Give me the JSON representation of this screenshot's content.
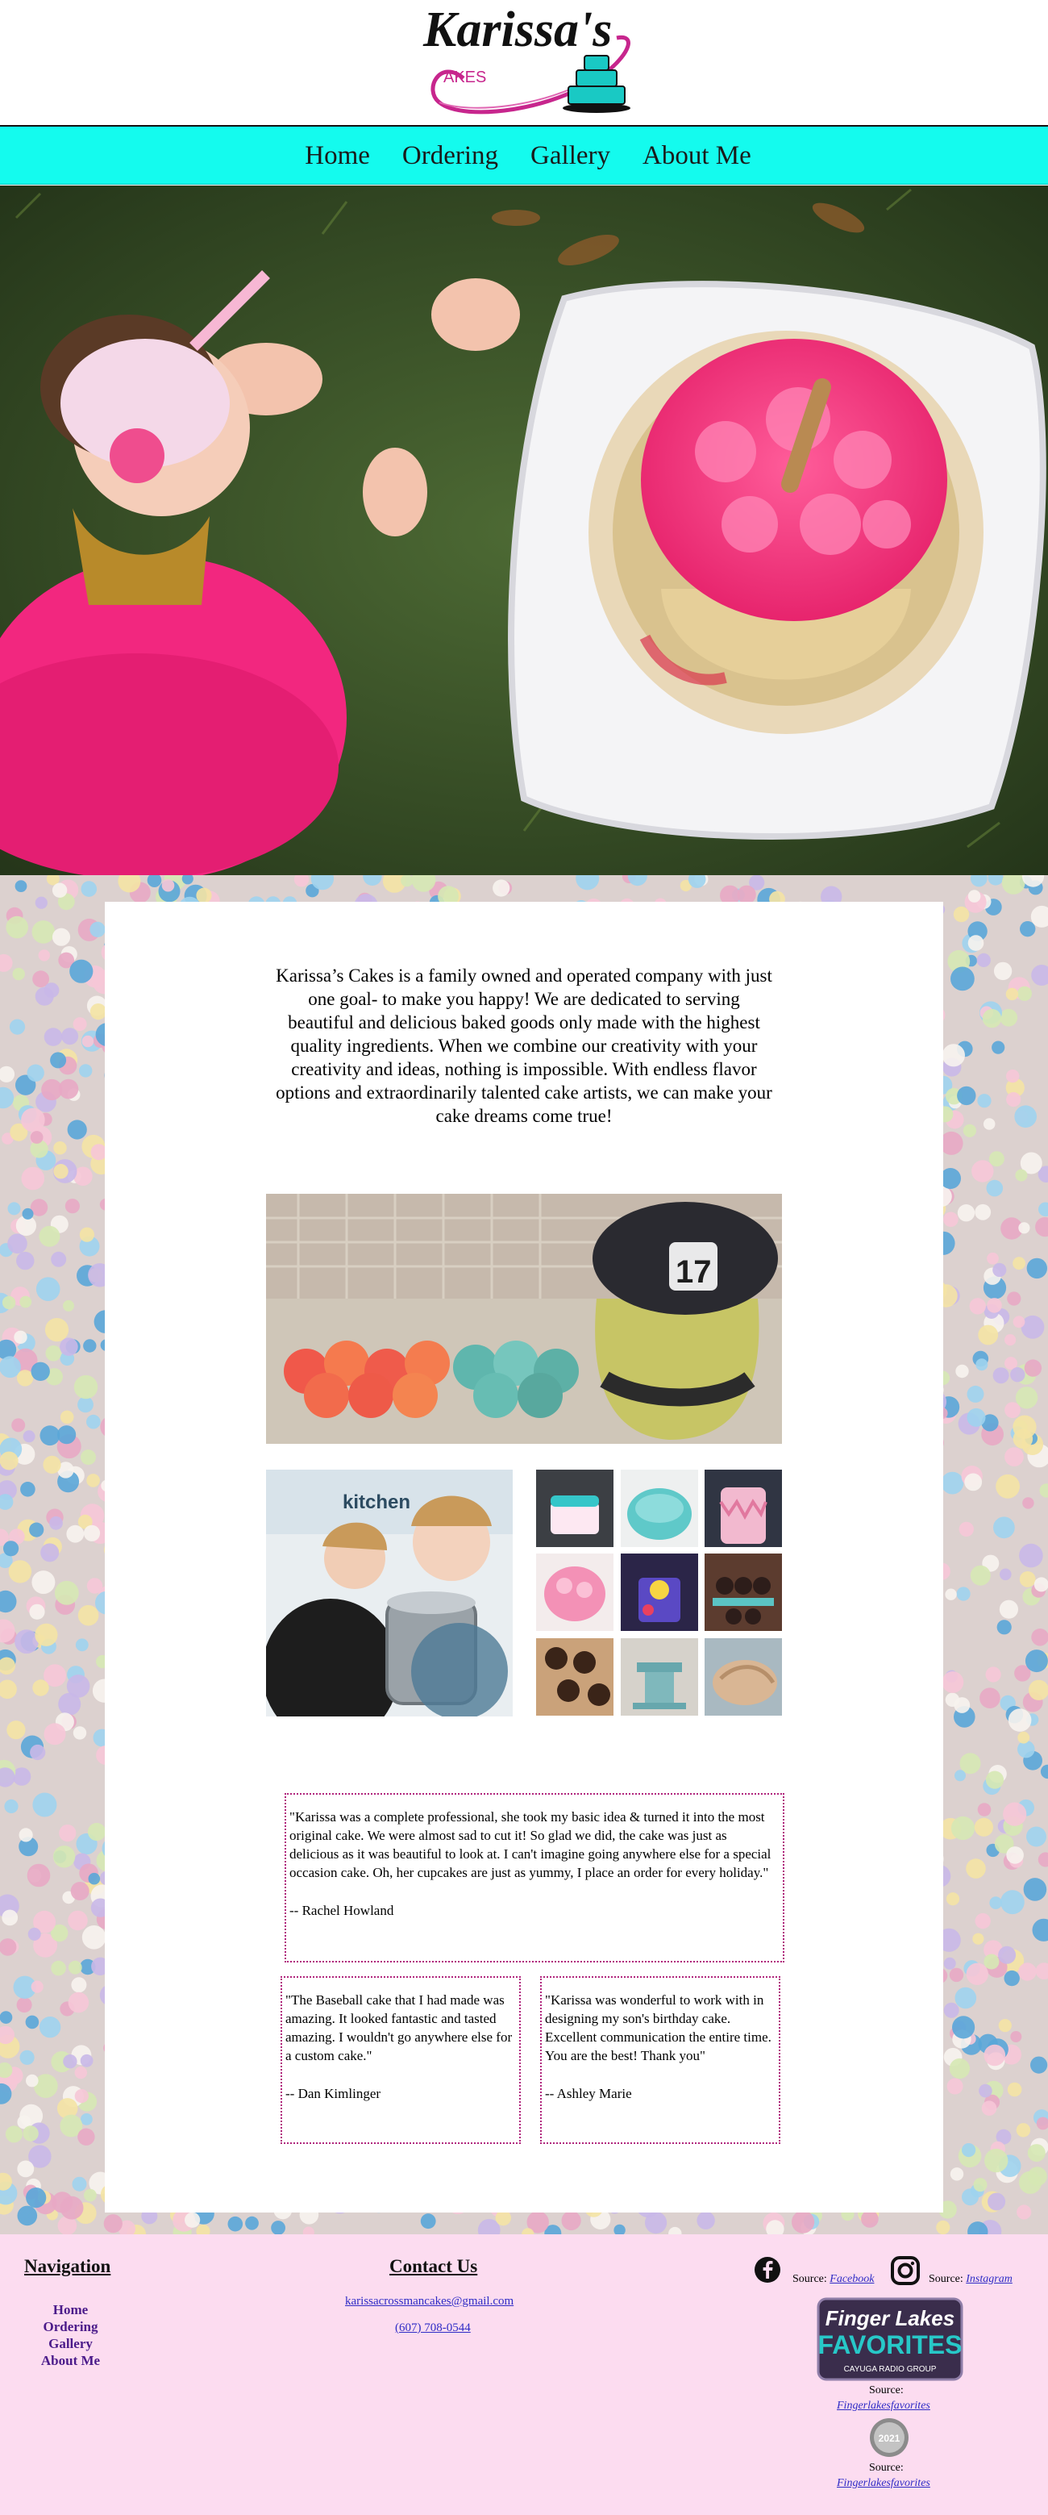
{
  "header": {
    "logo_text": "Karissa's",
    "logo_subtext": "AKES"
  },
  "nav": {
    "items": [
      {
        "label": "Home"
      },
      {
        "label": "Ordering"
      },
      {
        "label": "Gallery"
      },
      {
        "label": "About Me"
      }
    ]
  },
  "main": {
    "intro": "Karissa’s Cakes is a family owned and operated company with just one goal- to make you happy! We are dedicated to serving beautiful and delicious baked goods only made with the highest quality ingredients. When we combine our creativity with your creativity and ideas, nothing is impossible. With endless flavor options and extraordinarily talented cake artists, we can make your cake dreams come true!",
    "photo_helmet_text": "17",
    "photo_kitchen_text": "kitchen",
    "reviews": [
      {
        "quote": "\"Karissa was a complete professional, she took my basic idea & turned it into the most original cake. We were almost sad to cut it! So glad we did, the cake was just as delicious as it was beautiful to look at. I can't imagine going anywhere else for a special occasion cake. Oh, her cupcakes are just as yummy, I place an order for every holiday.\"",
        "author": "-- Rachel Howland"
      },
      {
        "quote": "\"The Baseball cake that I had made was amazing. It looked fantastic and tasted amazing. I wouldn't go anywhere else for a custom cake.\"",
        "author": "-- Dan Kimlinger"
      },
      {
        "quote": "\"Karissa was wonderful to work with in designing my son's birthday cake. Excellent communication the entire time. You are the best! Thank you\"",
        "author": "-- Ashley Marie"
      }
    ]
  },
  "footer": {
    "nav_heading": "Navigation",
    "nav_links": [
      "Home",
      "Ordering",
      "Gallery",
      "About Me"
    ],
    "contact_heading": "Contact Us",
    "email": "karissacrossmancakes@gmail.com",
    "phone": "(607) 708-0544",
    "source_label": "Source:",
    "facebook_label": "Facebook",
    "instagram_label": "Instagram",
    "fl_label": "Fingerlakesfavorites",
    "fl_logo_line1": "Finger Lakes",
    "fl_logo_line2": "FAVORITES",
    "fl_logo_line3": "CAYUGA RADIO GROUP",
    "badge_year": "2021"
  },
  "colors": {
    "nav_bg": "#14fbee",
    "footer_bg": "#fcdcf0",
    "review_border": "#b0247c",
    "link": "#2f2cc6"
  }
}
